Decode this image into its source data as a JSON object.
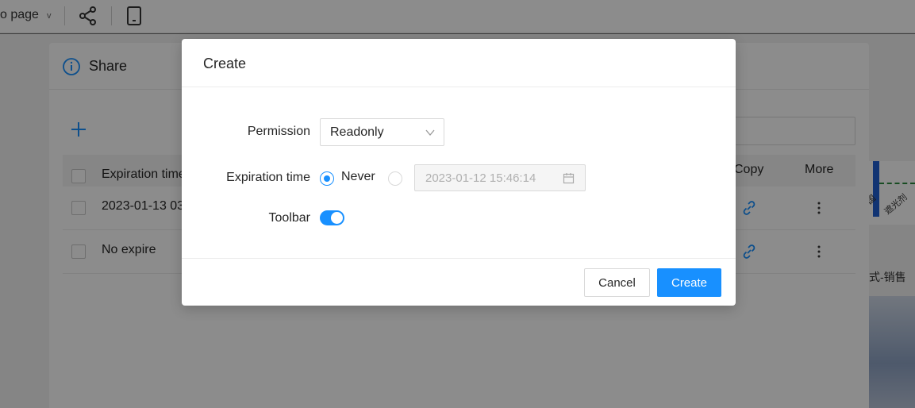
{
  "topbar": {
    "page_select": "o page",
    "chevron": "v"
  },
  "background": {
    "zh_title": "式-销售",
    "axis_labels": [
      "国",
      "遮光剂"
    ]
  },
  "share_dialog": {
    "title": "Share",
    "table": {
      "headers": {
        "expiration": "Expiration time",
        "copy": "Copy",
        "more": "More"
      },
      "rows": [
        {
          "expiration": "2023-01-13 03"
        },
        {
          "expiration": "No expire"
        }
      ]
    }
  },
  "create_modal": {
    "title": "Create",
    "permission": {
      "label": "Permission",
      "value": "Readonly"
    },
    "expiration": {
      "label": "Expiration time",
      "never_label": "Never",
      "date_value": "2023-01-12 15:46:14"
    },
    "toolbar": {
      "label": "Toolbar",
      "enabled": true
    },
    "buttons": {
      "cancel": "Cancel",
      "create": "Create"
    }
  },
  "colors": {
    "primary": "#1890ff",
    "text": "#262626",
    "border": "#d9d9d9"
  }
}
